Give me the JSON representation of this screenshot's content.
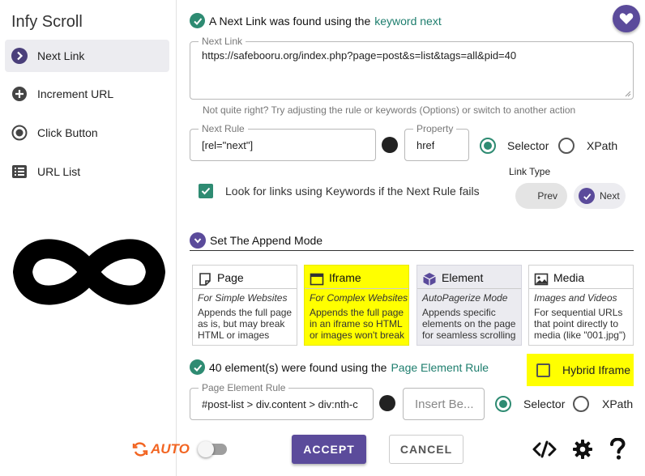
{
  "app": {
    "title": "Infy Scroll"
  },
  "sidebar": {
    "items": [
      {
        "label": "Next Link",
        "icon": "chevron-right-circle-icon",
        "active": true
      },
      {
        "label": "Increment URL",
        "icon": "plus-circle-icon",
        "active": false
      },
      {
        "label": "Click Button",
        "icon": "radio-target-icon",
        "active": false
      },
      {
        "label": "URL List",
        "icon": "list-icon",
        "active": false
      }
    ],
    "logo": "infinity-logo"
  },
  "next_link": {
    "found_text": "A Next Link was found using the",
    "found_link": "keyword next",
    "field_label": "Next Link",
    "field_value": "https://safebooru.org/index.php?page=post&s=list&tags=all&pid=40",
    "hint": "Not quite right? Try adjusting the rule or keywords (Options) or switch to another action",
    "rule_label": "Next Rule",
    "rule_value": "[rel=\"next\"]",
    "property_label": "Property",
    "property_value": "href",
    "selector_label": "Selector",
    "xpath_label": "XPath",
    "keywords_checkbox": "Look for links using Keywords if the Next Rule fails",
    "link_type_label": "Link Type",
    "prev_label": "Prev",
    "next_label": "Next"
  },
  "append": {
    "heading": "Set The Append Mode",
    "cards": [
      {
        "title": "Page",
        "subtitle": "For Simple Websites",
        "desc": "Appends the full page as is, but may break HTML or images",
        "icon": "page-icon"
      },
      {
        "title": "Iframe",
        "subtitle": "For Complex Websites",
        "desc": "Appends the full page in an iframe so HTML or images won't break",
        "icon": "iframe-icon"
      },
      {
        "title": "Element",
        "subtitle": "AutoPagerize Mode",
        "desc": "Appends specific elements on the page for seamless scrolling",
        "icon": "cube-icon"
      },
      {
        "title": "Media",
        "subtitle": "Images and Videos",
        "desc": "For sequential URLs that point directly to media (like \"001.jpg\")",
        "icon": "image-icon"
      }
    ]
  },
  "page_element": {
    "found_text": "40 element(s) were found using the",
    "found_link": "Page Element Rule",
    "hybrid_label": "Hybrid Iframe",
    "rule_label": "Page Element Rule",
    "rule_value": "#post-list > div.content > div:nth-c",
    "insert_placeholder": "Insert Be...",
    "selector_label": "Selector",
    "xpath_label": "XPath"
  },
  "footer": {
    "auto_label": "AUTO",
    "accept_label": "ACCEPT",
    "cancel_label": "CANCEL"
  },
  "colors": {
    "accent": "#5b4b9b",
    "teal": "#2e8b72",
    "highlight": "#ffff00",
    "auto_orange": "#f26522"
  }
}
